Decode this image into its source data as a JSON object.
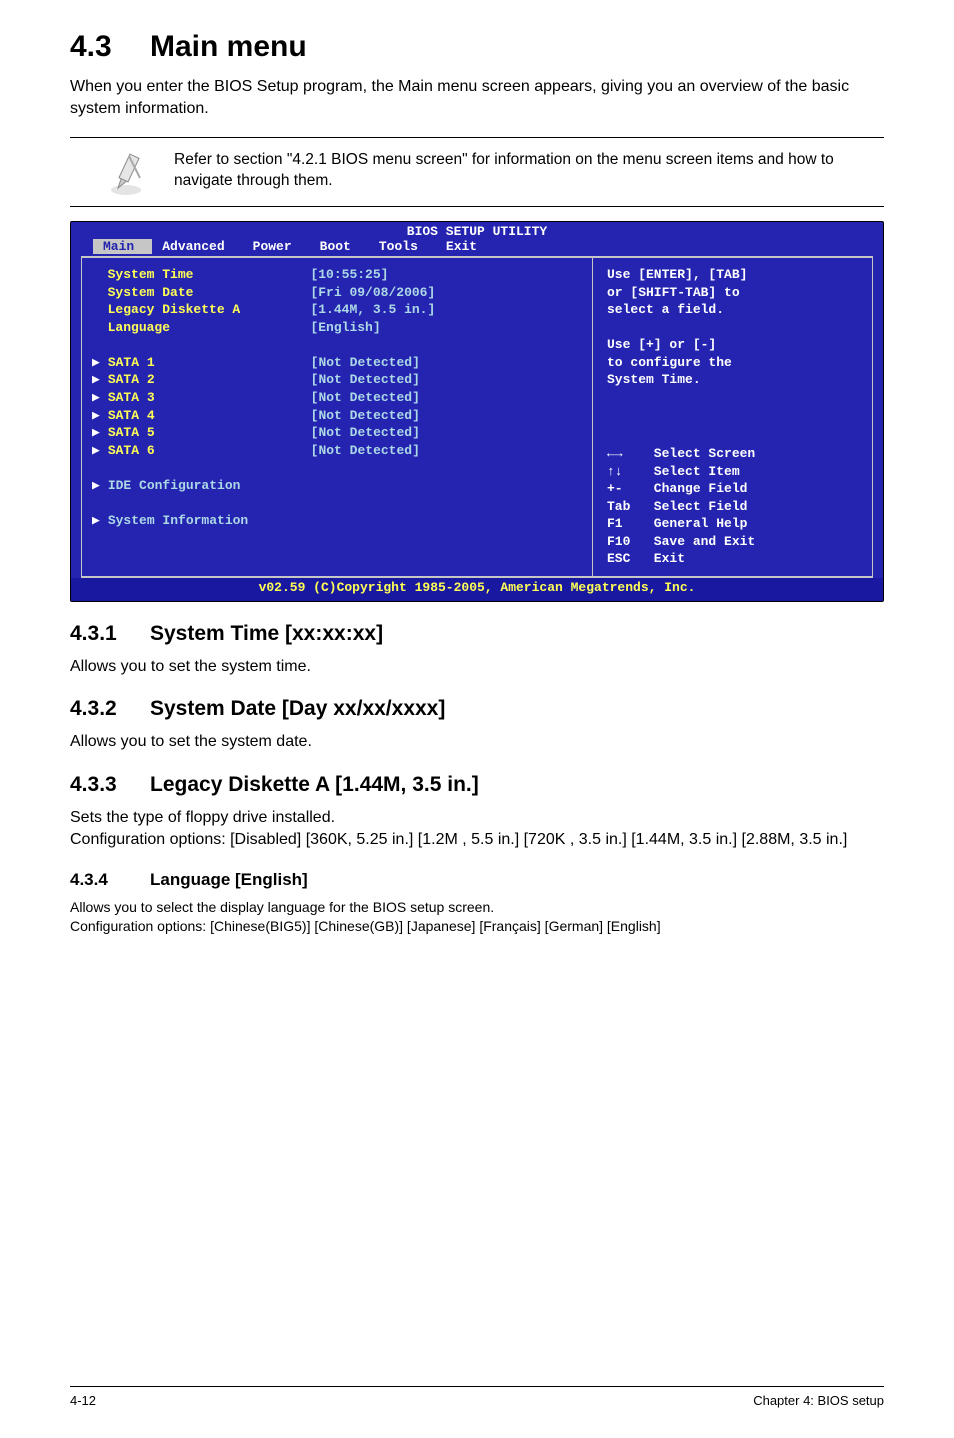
{
  "heading": {
    "num": "4.3",
    "title": "Main menu"
  },
  "intro": "When you enter the BIOS Setup program, the Main menu screen appears, giving you an overview of the basic system information.",
  "note": "Refer to section \"4.2.1  BIOS menu screen\" for information on the menu screen items and how to navigate through them.",
  "bios": {
    "title": "BIOS SETUP UTILITY",
    "menus": [
      "Main",
      "Advanced",
      "Power",
      "Boot",
      "Tools",
      "Exit"
    ],
    "left_rows": [
      {
        "label": "System Time",
        "value": "[10:55:25]",
        "tri": false,
        "cyan": true
      },
      {
        "label": "System Date",
        "value": "[Fri 09/08/2006]",
        "tri": false,
        "cyan": true
      },
      {
        "label": "Legacy Diskette A",
        "value": "[1.44M, 3.5 in.]",
        "tri": false,
        "cyan": true
      },
      {
        "label": "Language",
        "value": "[English]",
        "tri": false,
        "cyan": true
      },
      {
        "blank": true
      },
      {
        "label": "SATA 1",
        "value": "[Not Detected]",
        "tri": true,
        "cyan": true
      },
      {
        "label": "SATA 2",
        "value": "[Not Detected]",
        "tri": true,
        "cyan": true
      },
      {
        "label": "SATA 3",
        "value": "[Not Detected]",
        "tri": true,
        "cyan": true
      },
      {
        "label": "SATA 4",
        "value": "[Not Detected]",
        "tri": true,
        "cyan": true
      },
      {
        "label": "SATA 5",
        "value": "[Not Detected]",
        "tri": true,
        "cyan": true
      },
      {
        "label": "SATA 6",
        "value": "[Not Detected]",
        "tri": true,
        "cyan": true
      },
      {
        "blank": true
      },
      {
        "label": "IDE Configuration",
        "value": "",
        "tri": true,
        "cyan": false
      },
      {
        "blank": true
      },
      {
        "label": "System Information",
        "value": "",
        "tri": true,
        "cyan": false
      }
    ],
    "help_top": "Use [ENTER], [TAB]\nor [SHIFT-TAB] to\nselect a field.\n\nUse [+] or [-]\nto configure the\nSystem Time.",
    "help_keys": [
      {
        "key": "←→",
        "label": "Select Screen"
      },
      {
        "key": "↑↓",
        "label": "Select Item"
      },
      {
        "key": "+-",
        "label": "Change Field"
      },
      {
        "key": "Tab",
        "label": "Select Field"
      },
      {
        "key": "F1",
        "label": "General Help"
      },
      {
        "key": "F10",
        "label": "Save and Exit"
      },
      {
        "key": "ESC",
        "label": "Exit"
      }
    ],
    "footer": "v02.59 (C)Copyright 1985-2005, American Megatrends, Inc."
  },
  "s431": {
    "num": "4.3.1",
    "title": "System Time [xx:xx:xx]",
    "body": "Allows you to set the system time."
  },
  "s432": {
    "num": "4.3.2",
    "title": "System Date [Day xx/xx/xxxx]",
    "body": "Allows you to set the system date."
  },
  "s433": {
    "num": "4.3.3",
    "title": "Legacy Diskette A [1.44M, 3.5 in.]",
    "body1": "Sets the type of floppy drive installed.",
    "body2": "Configuration options: [Disabled] [360K, 5.25 in.] [1.2M , 5.5 in.] [720K , 3.5 in.] [1.44M, 3.5 in.] [2.88M, 3.5 in.]"
  },
  "s434": {
    "num": "4.3.4",
    "title": "Language [English]",
    "body1": "Allows you to select the display language for the BIOS setup screen.",
    "body2": "Configuration options: [Chinese(BIG5)] [Chinese(GB)] [Japanese] [Français] [German] [English]"
  },
  "footer": {
    "left": "4-12",
    "right": "Chapter 4: BIOS setup"
  }
}
